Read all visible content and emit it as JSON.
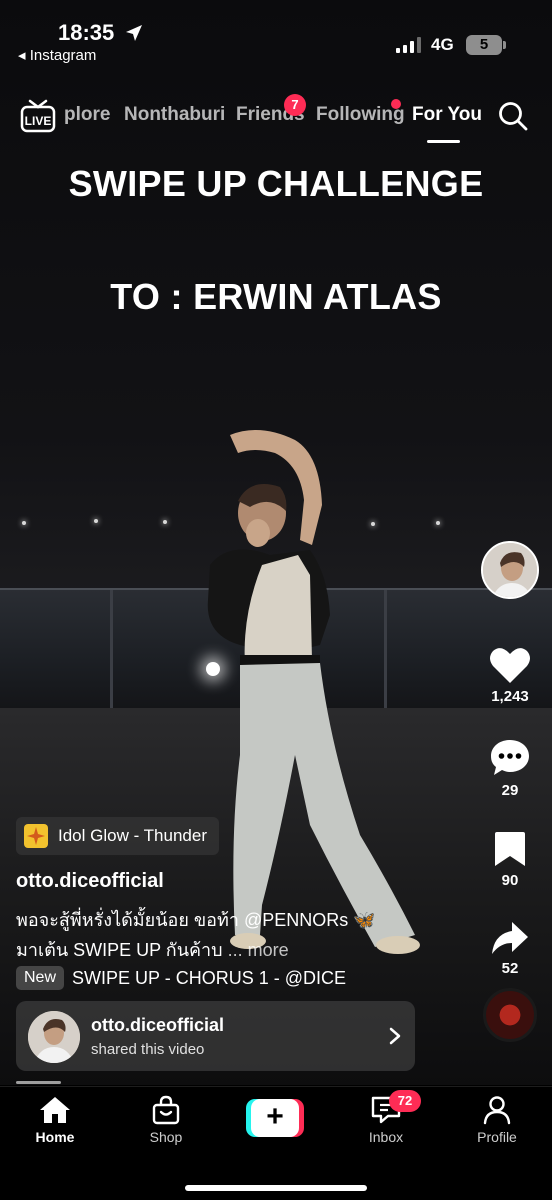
{
  "status_bar": {
    "time": "18:35",
    "back_app": "◂ Instagram",
    "network": "4G",
    "battery": "5"
  },
  "top_nav": {
    "live_label": "LIVE",
    "tabs": [
      {
        "label": "plore"
      },
      {
        "label": "Nonthaburi"
      },
      {
        "label": "Friends",
        "badge": "7"
      },
      {
        "label": "Following"
      },
      {
        "label": "For You"
      }
    ]
  },
  "video": {
    "overlay_line1": "SWIPE UP CHALLENGE",
    "overlay_line2": "TO : ERWIN ATLAS"
  },
  "right_rail": {
    "likes": "1,243",
    "comments": "29",
    "bookmarks": "90",
    "shares": "52"
  },
  "post": {
    "sound_chip": "Idol Glow - Thunder",
    "username": "otto.diceofficial",
    "caption_line1": "พอจะสู้พี่หรั่งได้มั้ยน้อย ขอท้า @PENNORs 🦋",
    "caption_line2": "มาเต้น SWIPE UP กันค้าบ",
    "caption_more": " ... more",
    "new_badge": "New",
    "music": "SWIPE UP - CHORUS 1 - @DICE",
    "shared_name": "otto.diceofficial",
    "shared_sub": "shared this video"
  },
  "tab_bar": {
    "home": "Home",
    "shop": "Shop",
    "inbox": "Inbox",
    "inbox_badge": "72",
    "profile": "Profile"
  },
  "colors": {
    "accent_red": "#fe2c55",
    "accent_cyan": "#25f4ee",
    "background": "#000000"
  }
}
